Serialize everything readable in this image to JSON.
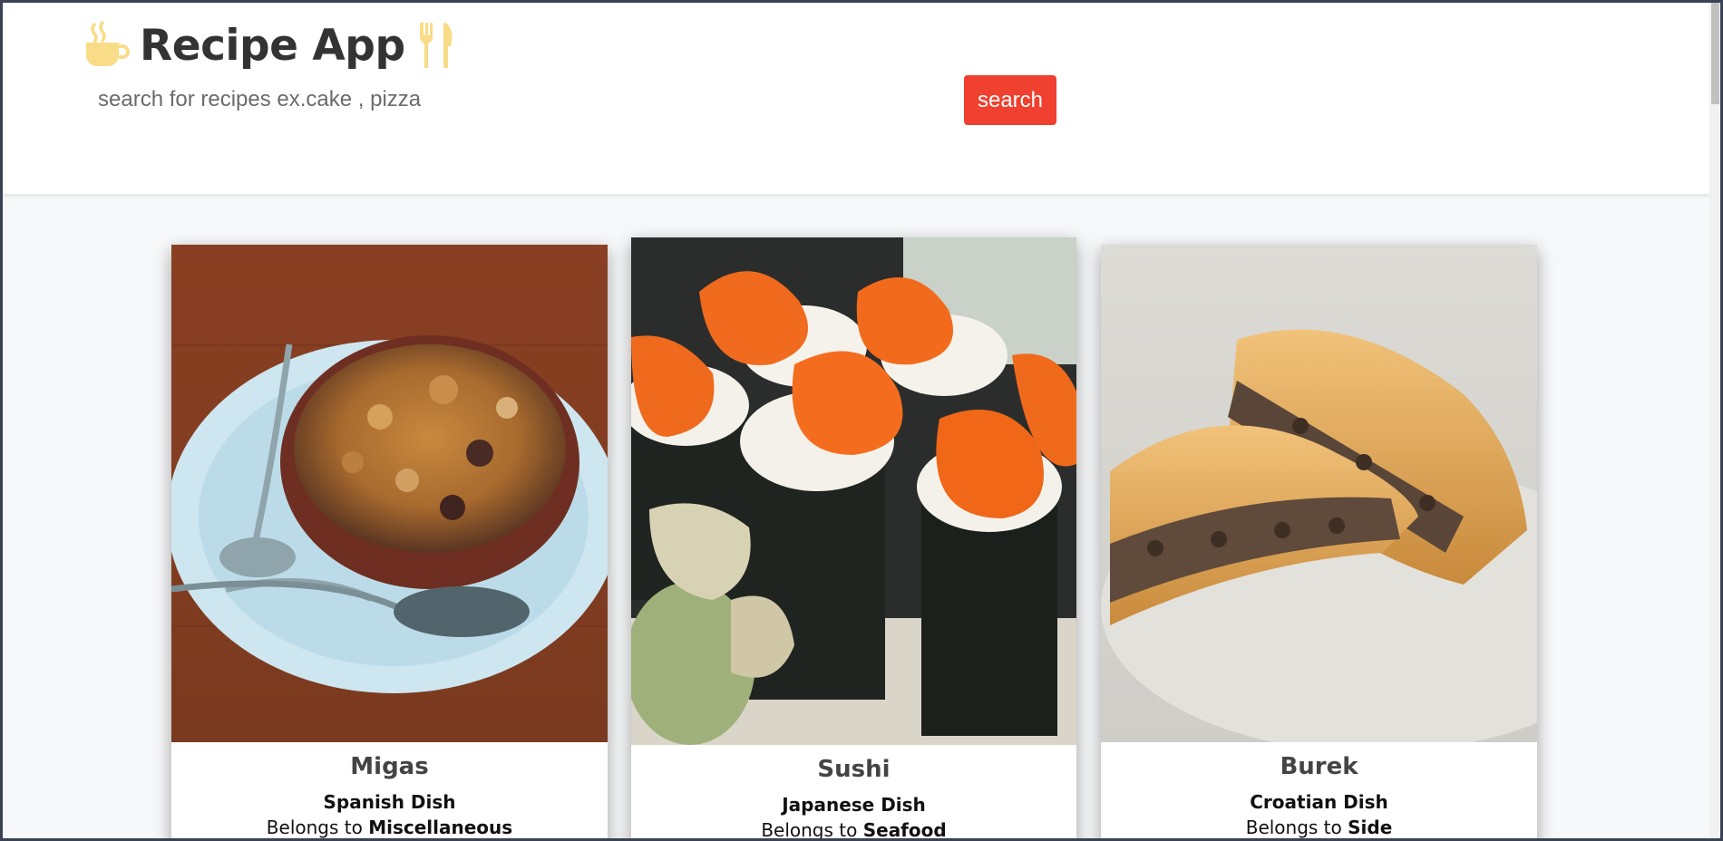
{
  "app": {
    "title": "Recipe App"
  },
  "search": {
    "placeholder": "search for recipes ex.cake , pizza",
    "value": "",
    "button_label": "search"
  },
  "colors": {
    "accent": "#f0402f",
    "icon_yellow": "#f8dc87",
    "title_text": "#333333"
  },
  "icons": {
    "left": "coffee-cup-icon",
    "right": "fork-knife-icon"
  },
  "recipes": [
    {
      "name": "Migas",
      "cuisine": "Spanish Dish",
      "belongs_prefix": "Belongs to",
      "category": "Miscellaneous",
      "image": "bowl-of-migas-on-plate"
    },
    {
      "name": "Sushi",
      "cuisine": "Japanese Dish",
      "belongs_prefix": "Belongs to",
      "category": "Seafood",
      "image": "sushi-rolls-with-roe"
    },
    {
      "name": "Burek",
      "cuisine": "Croatian Dish",
      "belongs_prefix": "Belongs to",
      "category": "Side",
      "image": "burek-pastry-on-plate"
    }
  ]
}
